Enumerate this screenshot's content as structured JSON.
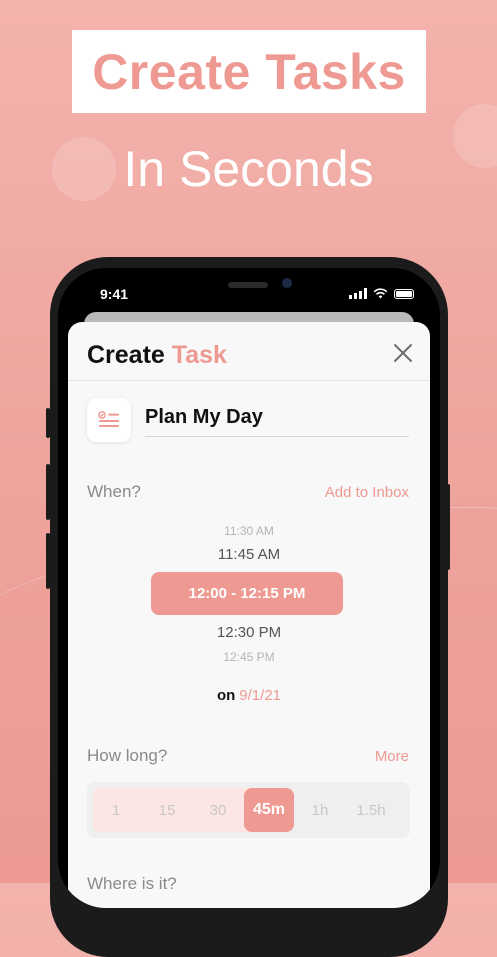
{
  "promo": {
    "title": "Create Tasks",
    "subtitle": "In Seconds"
  },
  "status_bar": {
    "time": "9:41"
  },
  "sheet": {
    "title_part1": "Create",
    "title_part2": "Task",
    "close_icon": "close-icon",
    "task_name": "Plan My Day",
    "task_icon": "checklist-icon"
  },
  "when": {
    "label": "When?",
    "add_to_inbox": "Add to Inbox",
    "times": [
      "11:30 AM",
      "11:45 AM",
      "12:00 - 12:15 PM",
      "12:30 PM",
      "12:45 PM"
    ],
    "on_label": "on",
    "date": "9/1/21"
  },
  "how_long": {
    "label": "How long?",
    "more": "More",
    "options": [
      "1",
      "15",
      "30",
      "45m",
      "1h",
      "1.5h"
    ],
    "selected": "45m"
  },
  "next_section": {
    "label": "Where is it?"
  },
  "colors": {
    "accent": "#ee9a92",
    "background_top": "#f3b3ad",
    "sheet": "#f8f8f8"
  }
}
